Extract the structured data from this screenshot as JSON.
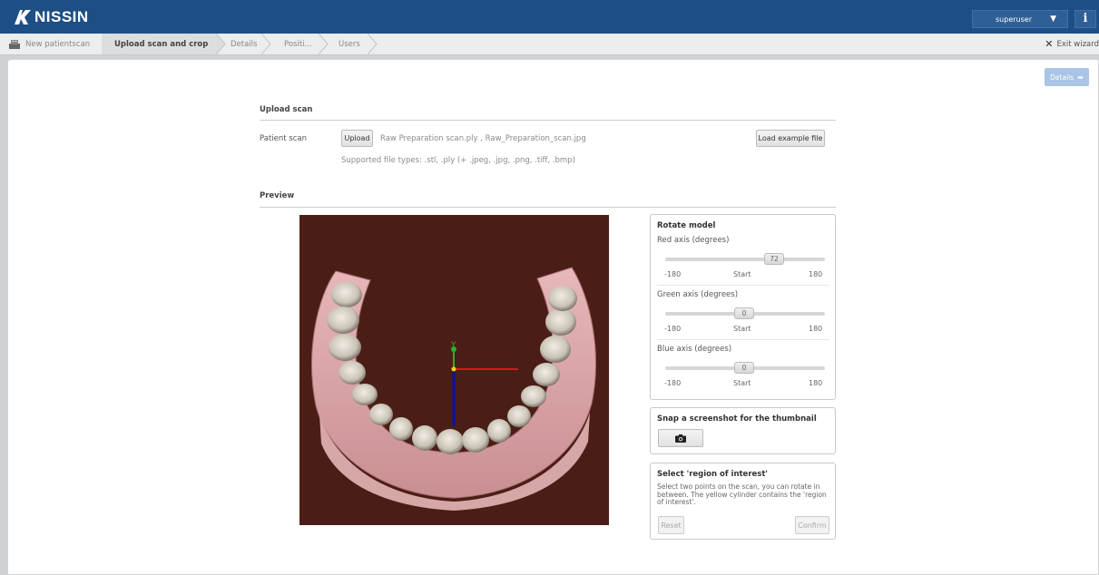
{
  "app": {
    "brand": "NISSIN"
  },
  "header": {
    "user": "superuser",
    "info_glyph": "i"
  },
  "breadcrumb": {
    "items": [
      {
        "label": "New patientscan"
      },
      {
        "label": "Upload scan and crop"
      },
      {
        "label": "Details"
      },
      {
        "label": "Positi..."
      },
      {
        "label": "Users"
      }
    ],
    "active_index": 1,
    "exit_label": "Exit wizard"
  },
  "nav": {
    "details_button": "Details"
  },
  "upload": {
    "title": "Upload scan",
    "patient_scan_label": "Patient scan",
    "upload_button": "Upload",
    "files": "Raw Preparation scan.ply , Raw_Preparation_scan.jpg",
    "example_button": "Load example file",
    "supported": "Supported file types: .stl, .ply (+ .jpeg, .jpg, .png, .tiff, .bmp)"
  },
  "preview": {
    "title": "Preview",
    "axis_label": "Y"
  },
  "rotate": {
    "title": "Rotate model",
    "axes": [
      {
        "label": "Red axis (degrees)",
        "value": "72",
        "min": "-180",
        "mid": "Start",
        "max": "180",
        "fraction": 0.7
      },
      {
        "label": "Green axis (degrees)",
        "value": "0",
        "min": "-180",
        "mid": "Start",
        "max": "180",
        "fraction": 0.5
      },
      {
        "label": "Blue axis (degrees)",
        "value": "0",
        "min": "-180",
        "mid": "Start",
        "max": "180",
        "fraction": 0.5
      }
    ]
  },
  "snapshot": {
    "title": "Snap a screenshot for the thumbnail"
  },
  "roi": {
    "title": "Select 'region of interest'",
    "description": "Select two points on the scan, you can rotate in between. The yellow cylinder contains the 'region of interest'.",
    "reset_button": "Reset",
    "confirm_button": "Confirm"
  },
  "colors": {
    "brand": "#1d4f86",
    "viewer_bg": "#4a1e16",
    "axis_x": "#e0141a",
    "axis_y": "#29b130",
    "axis_z": "#0a10a6",
    "origin": "#ffd400"
  },
  "icons": {
    "logo": "nissin-logo-icon",
    "wizard": "wizard-icon",
    "close": "close-icon",
    "arrow": "arrow-right-icon",
    "camera": "camera-icon",
    "caret": "caret-down-icon"
  }
}
